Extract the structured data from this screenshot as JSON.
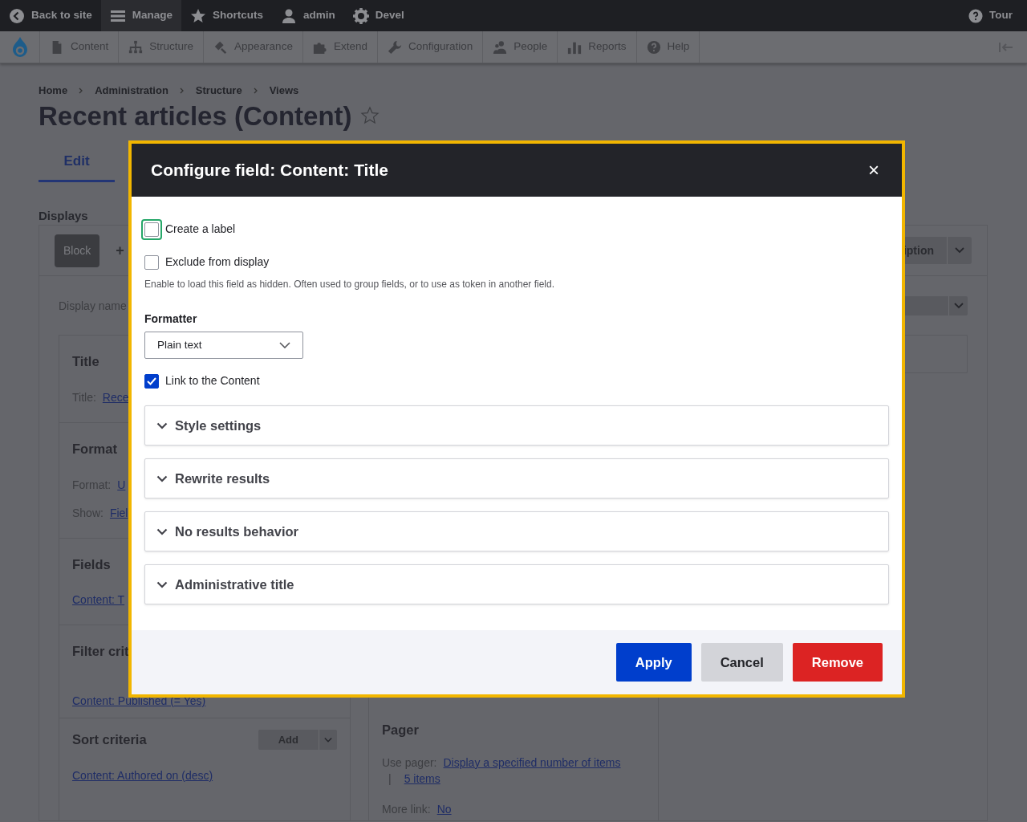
{
  "toolbar": {
    "items": [
      {
        "label": "Back to site",
        "selected": false
      },
      {
        "label": "Manage",
        "selected": true
      },
      {
        "label": "Shortcuts",
        "selected": false
      },
      {
        "label": "admin",
        "selected": false
      },
      {
        "label": "Devel",
        "selected": false
      }
    ],
    "right": "Tour"
  },
  "admin_menu": [
    "Content",
    "Structure",
    "Appearance",
    "Extend",
    "Configuration",
    "People",
    "Reports",
    "Help"
  ],
  "breadcrumb": [
    "Home",
    "Administration",
    "Structure",
    "Views"
  ],
  "page_title": "Recent articles (Content)",
  "tabs": [
    {
      "label": "Edit",
      "selected": true
    }
  ],
  "displays": {
    "heading": "Displays",
    "display_button": "Block",
    "add_label": "+",
    "actions_label": "iption",
    "display_name_label": "Display name"
  },
  "left_sections": [
    {
      "title": "Title",
      "lines": [
        {
          "label": "Title:",
          "link": "Rece"
        }
      ]
    },
    {
      "title": "Format",
      "lines": [
        {
          "label": "Format:",
          "link": "U"
        },
        {
          "label": "Show:",
          "link": "Fiel"
        }
      ]
    },
    {
      "title": "Fields",
      "lines": [
        {
          "link": "Content: T"
        }
      ]
    },
    {
      "title": "Filter crit",
      "lines": [
        {
          "link": "Content: Published (= Yes)"
        }
      ]
    },
    {
      "title": "Sort criteria",
      "button": "Add",
      "lines": [
        {
          "link": "Content: Authored on (desc)"
        }
      ]
    }
  ],
  "pager": {
    "title": "Pager",
    "lines": [
      {
        "label": "Use pager:",
        "link": "Display a specified number of items"
      },
      {
        "label": "|",
        "link": "5 items"
      },
      {
        "label": "More link:",
        "link": "No"
      }
    ]
  },
  "modal": {
    "title": "Configure field: Content: Title",
    "close": "×",
    "fields": [
      {
        "kind": "checkbox",
        "label": "Create a label",
        "checked": false,
        "focused": true
      },
      {
        "kind": "checkbox",
        "label": "Exclude from display",
        "checked": false,
        "focused": false,
        "description": "Enable to load this field as hidden. Often used to group fields, or to use as token in another field."
      },
      {
        "kind": "select",
        "label": "Formatter",
        "value": "Plain text"
      },
      {
        "kind": "checkbox",
        "label": "Link to the Content",
        "checked": true,
        "focused": false
      }
    ],
    "sections": [
      "Style settings",
      "Rewrite results",
      "No results behavior",
      "Administrative title"
    ],
    "buttons": [
      {
        "label": "Apply",
        "kind": "primary"
      },
      {
        "label": "Cancel",
        "kind": "secondary"
      },
      {
        "label": "Remove",
        "kind": "danger"
      }
    ]
  }
}
